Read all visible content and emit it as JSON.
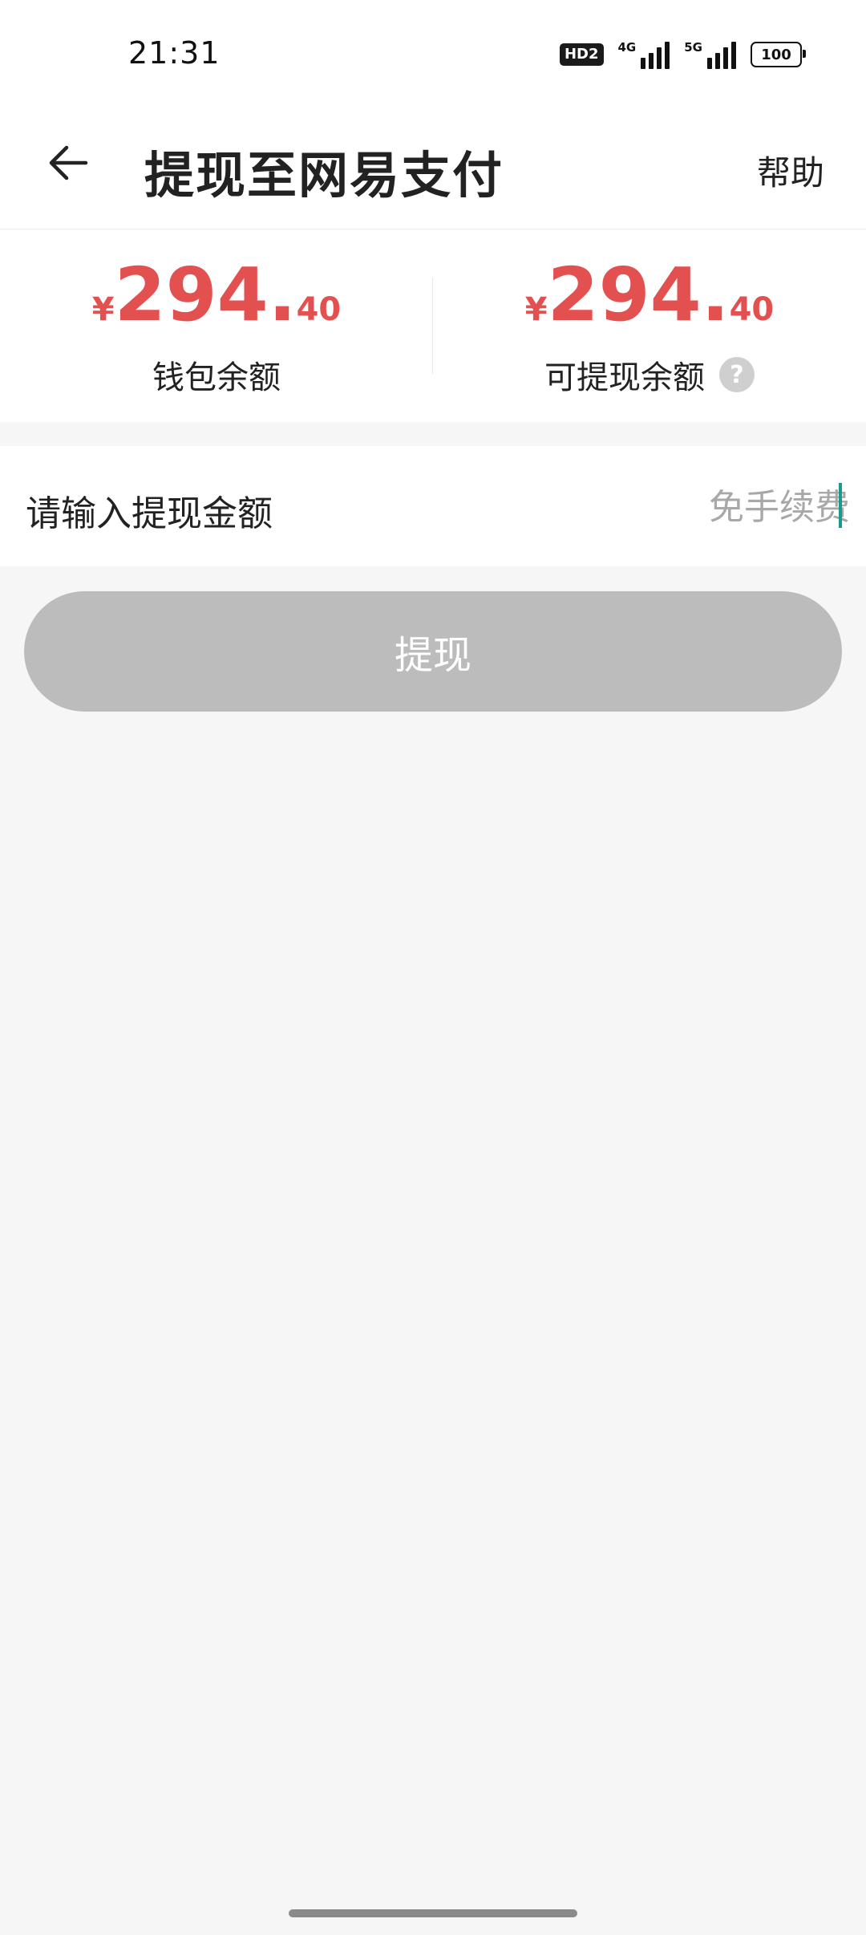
{
  "status_bar": {
    "time": "21:31",
    "hd_label": "HD2",
    "network_4g": "4G",
    "network_5g": "5G",
    "battery": "100"
  },
  "nav": {
    "back_icon": "arrow-left-icon",
    "title": "提现至网易支付",
    "help": "帮助"
  },
  "balances": {
    "wallet": {
      "currency": "¥",
      "integer": "294.",
      "decimal": "40",
      "label": "钱包余额"
    },
    "withdrawable": {
      "currency": "¥",
      "integer": "294.",
      "decimal": "40",
      "label": "可提现余额",
      "help_icon": "question-circle-icon",
      "help_glyph": "?"
    }
  },
  "input": {
    "label": "请输入提现金额",
    "value": "",
    "placeholder": "免手续费"
  },
  "action": {
    "withdraw_label": "提现"
  },
  "colors": {
    "amount": "#e35050",
    "button_disabled": "#bcbcbc",
    "caret": "#1a9a8a",
    "background": "#f6f6f6"
  }
}
